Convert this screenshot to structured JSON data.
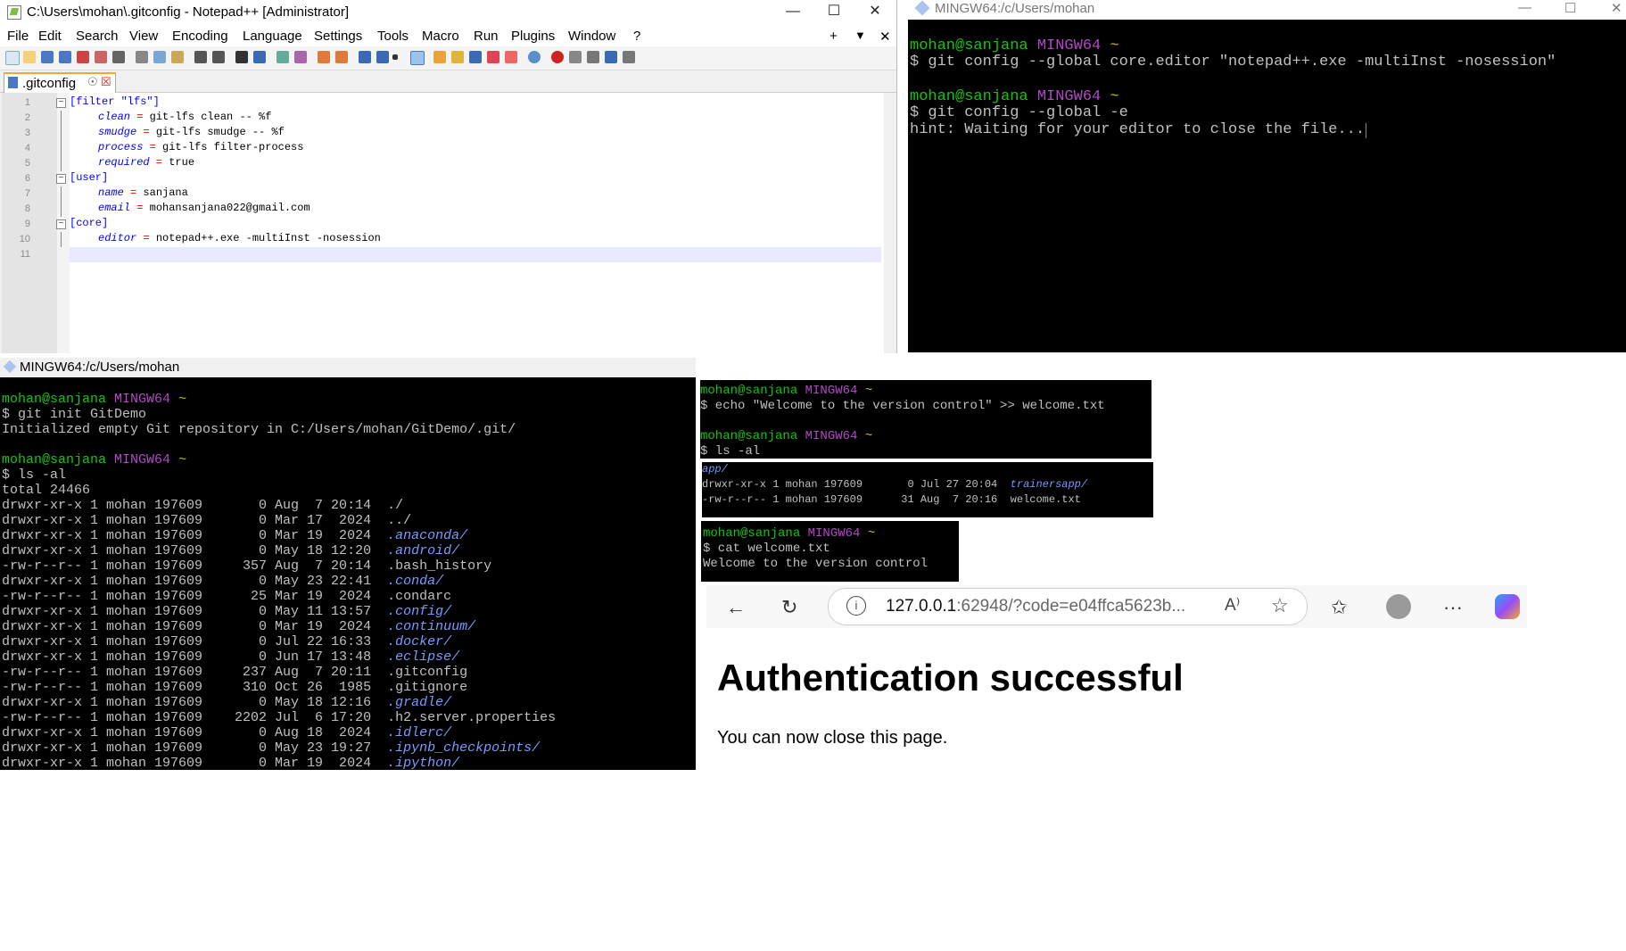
{
  "notepad": {
    "title": "C:\\Users\\mohan\\.gitconfig - Notepad++ [Administrator]",
    "menu": [
      "File",
      "Edit",
      "Search",
      "View",
      "Encoding",
      "Language",
      "Settings",
      "Tools",
      "Macro",
      "Run",
      "Plugins",
      "Window",
      "?"
    ],
    "tab": ".gitconfig",
    "lines": [
      {
        "n": "1",
        "sect": "[filter \"lfs\"]"
      },
      {
        "n": "2",
        "key": "clean",
        "val": " git-lfs clean -- %f"
      },
      {
        "n": "3",
        "key": "smudge",
        "val": " git-lfs smudge -- %f"
      },
      {
        "n": "4",
        "key": "process",
        "val": " git-lfs filter-process"
      },
      {
        "n": "5",
        "key": "required",
        "val": " true"
      },
      {
        "n": "6",
        "sect": "[user]"
      },
      {
        "n": "7",
        "key": "name",
        "val": " sanjana"
      },
      {
        "n": "8",
        "key": "email",
        "val": " mohansanjana022@gmail.com"
      },
      {
        "n": "9",
        "sect": "[core]"
      },
      {
        "n": "10",
        "key": "editor",
        "val": " notepad++.exe -multiInst -nosession"
      },
      {
        "n": "11"
      }
    ]
  },
  "term1": {
    "title": "MINGW64:/c/Users/mohan",
    "user": "mohan@sanjana",
    "env": "MINGW64",
    "tilde": "~",
    "cmd1": "$ git config --global core.editor \"notepad++.exe -multiInst -nosession\"",
    "cmd2": "$ git config --global -e",
    "hint": "hint: Waiting for your editor to close the file..."
  },
  "term2": {
    "title": "MINGW64:/c/Users/mohan",
    "user": "mohan@sanjana",
    "env": "MINGW64",
    "tilde": "~",
    "cmd1": "$ git init GitDemo",
    "out1": "Initialized empty Git repository in C:/Users/mohan/GitDemo/.git/",
    "cmd2": "$ ls -al",
    "total": "total 24466",
    "rows": [
      {
        "perm": "drwxr-xr-x 1 mohan 197609       0 Aug  7 20:14",
        "name": "./",
        "dir": false
      },
      {
        "perm": "drwxr-xr-x 1 mohan 197609       0 Mar 17  2024",
        "name": "../",
        "dir": false
      },
      {
        "perm": "drwxr-xr-x 1 mohan 197609       0 Mar 19  2024",
        "name": ".anaconda/",
        "dir": true
      },
      {
        "perm": "drwxr-xr-x 1 mohan 197609       0 May 18 12:20",
        "name": ".android/",
        "dir": true
      },
      {
        "perm": "-rw-r--r-- 1 mohan 197609     357 Aug  7 20:14",
        "name": ".bash_history",
        "dir": false
      },
      {
        "perm": "drwxr-xr-x 1 mohan 197609       0 May 23 22:41",
        "name": ".conda/",
        "dir": true
      },
      {
        "perm": "-rw-r--r-- 1 mohan 197609      25 Mar 19  2024",
        "name": ".condarc",
        "dir": false
      },
      {
        "perm": "drwxr-xr-x 1 mohan 197609       0 May 11 13:57",
        "name": ".config/",
        "dir": true
      },
      {
        "perm": "drwxr-xr-x 1 mohan 197609       0 Mar 19  2024",
        "name": ".continuum/",
        "dir": true
      },
      {
        "perm": "drwxr-xr-x 1 mohan 197609       0 Jul 22 16:33",
        "name": ".docker/",
        "dir": true
      },
      {
        "perm": "drwxr-xr-x 1 mohan 197609       0 Jun 17 13:48",
        "name": ".eclipse/",
        "dir": true
      },
      {
        "perm": "-rw-r--r-- 1 mohan 197609     237 Aug  7 20:11",
        "name": ".gitconfig",
        "dir": false
      },
      {
        "perm": "-rw-r--r-- 1 mohan 197609     310 Oct 26  1985",
        "name": ".gitignore",
        "dir": false
      },
      {
        "perm": "drwxr-xr-x 1 mohan 197609       0 May 18 12:16",
        "name": ".gradle/",
        "dir": true
      },
      {
        "perm": "-rw-r--r-- 1 mohan 197609    2202 Jul  6 17:20",
        "name": ".h2.server.properties",
        "dir": false
      },
      {
        "perm": "drwxr-xr-x 1 mohan 197609       0 Aug 18  2024",
        "name": ".idlerc/",
        "dir": true
      },
      {
        "perm": "drwxr-xr-x 1 mohan 197609       0 May 23 19:27",
        "name": ".ipynb_checkpoints/",
        "dir": true
      },
      {
        "perm": "drwxr-xr-x 1 mohan 197609       0 Mar 19  2024",
        "name": ".ipython/",
        "dir": true
      }
    ]
  },
  "term3": {
    "user": "mohan@sanjana",
    "env": "MINGW64",
    "tilde": "~",
    "cmd1": "$ echo \"Welcome to the version control\" >> welcome.txt",
    "cmd2": "$ ls -al"
  },
  "term4": {
    "app": "app/",
    "row1": "drwxr-xr-x 1 mohan 197609       0 Jul 27 20:04",
    "name1": "trainersapp/",
    "row2": "-rw-r--r-- 1 mohan 197609      31 Aug  7 20:16",
    "name2": "welcome.txt"
  },
  "term5": {
    "user": "mohan@sanjana",
    "env": "MINGW64",
    "tilde": "~",
    "cmd": "$ cat welcome.txt",
    "out": "Welcome to the version control"
  },
  "browser": {
    "url_host": "127.0.0.1",
    "url_rest": ":62948/?code=e04ffca5623b...",
    "heading": "Authentication successful",
    "message": "You can now close this page."
  }
}
